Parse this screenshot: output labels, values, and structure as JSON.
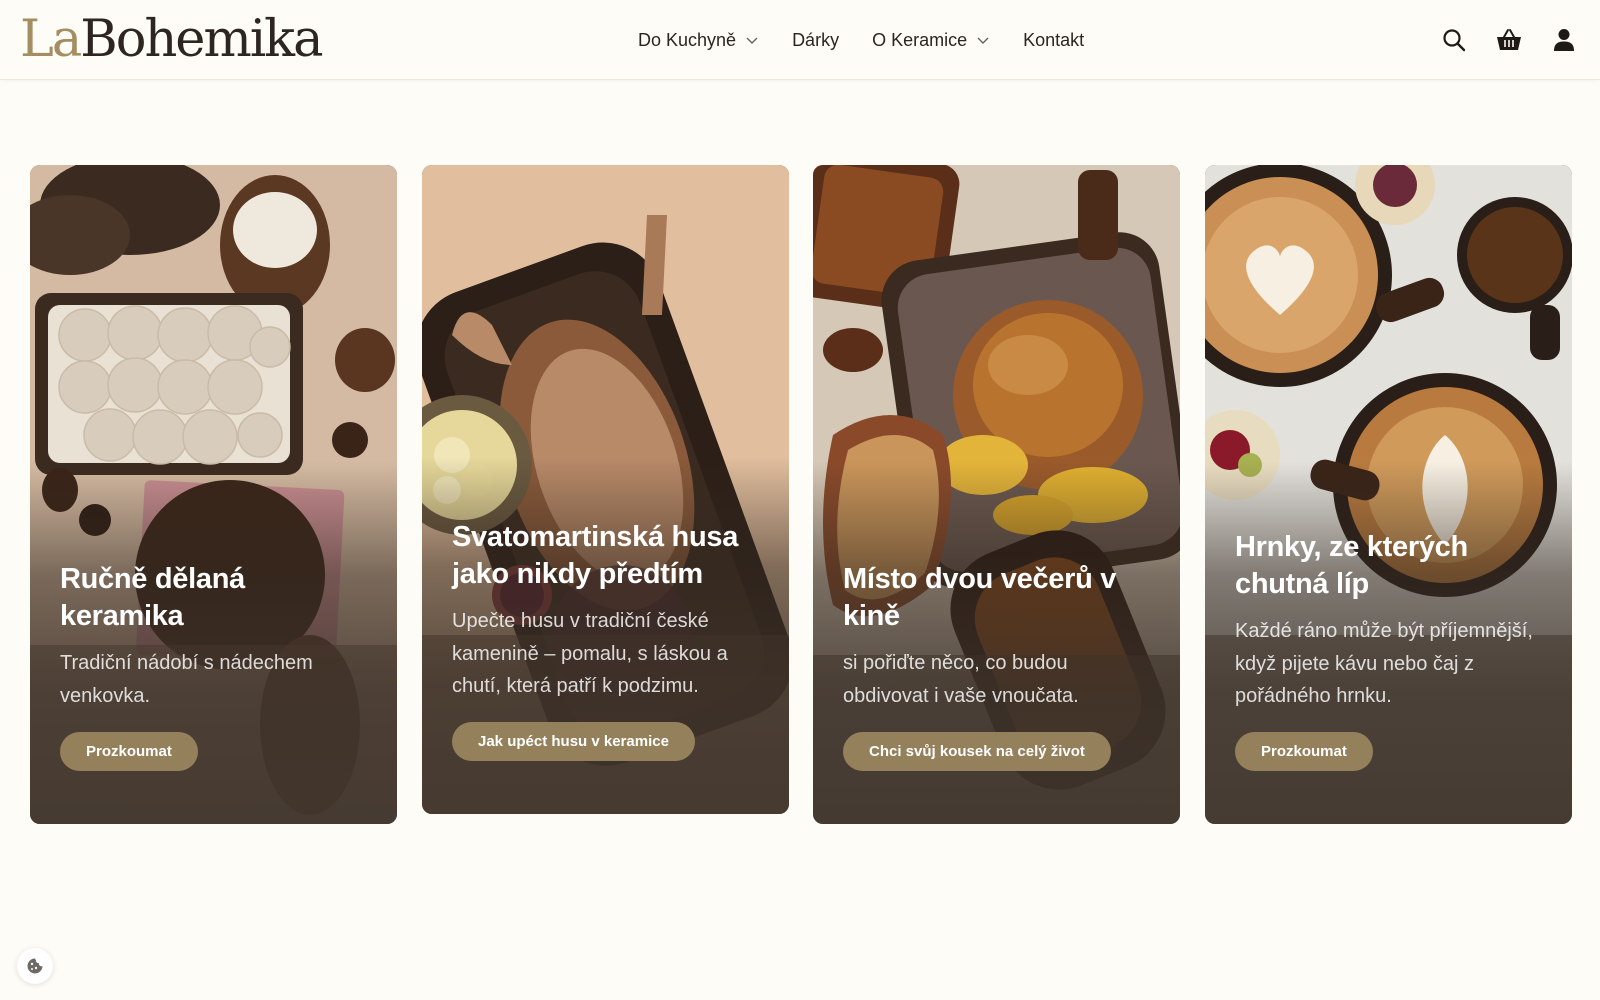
{
  "brand": {
    "logo_prefix": "La",
    "logo_main": "Bohemika"
  },
  "nav": {
    "items": [
      {
        "label": "Do Kuchyně",
        "has_dropdown": true
      },
      {
        "label": "Dárky",
        "has_dropdown": false
      },
      {
        "label": "O Keramice",
        "has_dropdown": true
      },
      {
        "label": "Kontakt",
        "has_dropdown": false
      }
    ]
  },
  "header_icons": [
    "search-icon",
    "basket-icon",
    "user-icon"
  ],
  "cards": [
    {
      "title": "Ručně dělaná keramika",
      "text": "Tradiční nádobí s nádechem venkovka.",
      "button": "Prozkoumat"
    },
    {
      "title": "Svatomartinská husa jako nikdy předtím",
      "text": "Upečte husu v tradiční české kamenině – pomalu, s láskou a chutí, která patří k podzimu.",
      "button": "Jak upéct husu v keramice"
    },
    {
      "title": "Místo dvou večerů v kině",
      "text": "si pořiďte něco, co budou obdivovat i vaše vnoučata.",
      "button": "Chci svůj kousek na celý život"
    },
    {
      "title": "Hrnky, ze kterých chutná líp",
      "text": "Každé ráno může být příjemnější, když pijete kávu nebo čaj z pořádného hrnku.",
      "button": "Prozkoumat"
    }
  ],
  "colors": {
    "background": "#fdfcf6",
    "button": "#94815c",
    "logo_accent": "#a58d62",
    "text": "#2b2520"
  },
  "cookie_icon": "cookie-icon"
}
